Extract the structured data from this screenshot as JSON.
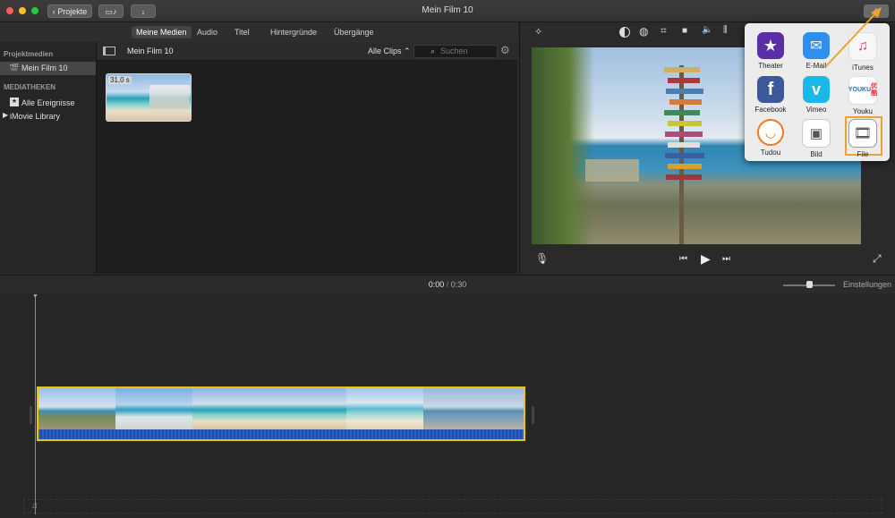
{
  "window": {
    "title": "Mein Film 10"
  },
  "toolbar": {
    "back_label": "Projekte"
  },
  "tabs": [
    {
      "label": "Meine Medien",
      "active": true
    },
    {
      "label": "Audio",
      "active": false
    },
    {
      "label": "Titel",
      "active": false
    },
    {
      "label": "Hintergründe",
      "active": false
    },
    {
      "label": "Übergänge",
      "active": false
    }
  ],
  "sidebar": {
    "project_heading": "Projektmedien",
    "project_item": "Mein Film 10",
    "libraries_heading": "MEDIATHEKEN",
    "items": [
      "Alle Ereignisse",
      "iMovie Library"
    ]
  },
  "browser": {
    "title": "Mein Film 10",
    "filter": "Alle Clips",
    "search_placeholder": "Suchen",
    "clip_duration": "31,0 s"
  },
  "share": {
    "apps": [
      {
        "label": "Theater",
        "icon": "star-icon",
        "color": "#5a2ea6"
      },
      {
        "label": "E-Mail",
        "icon": "mail-icon",
        "color": "#2d8ff0"
      },
      {
        "label": "iTunes",
        "icon": "music-note-icon",
        "color": "#f2f2f2"
      },
      {
        "label": "Facebook",
        "icon": "facebook-icon",
        "color": "#3b5998"
      },
      {
        "label": "Vimeo",
        "icon": "vimeo-icon",
        "color": "#1ab7ea"
      },
      {
        "label": "Youku",
        "icon": "youku-icon",
        "color": "#ffffff"
      },
      {
        "label": "Tudou",
        "icon": "tudou-icon",
        "color": "#ffffff"
      },
      {
        "label": "Bild",
        "icon": "image-icon",
        "color": "#ffffff"
      },
      {
        "label": "File",
        "icon": "film-icon",
        "color": "#ffffff"
      }
    ],
    "highlight_color": "#f0a030"
  },
  "timeline": {
    "current_time": "0:00",
    "separator": "/",
    "total_time": "0:30",
    "settings_label": "Einstellungen"
  }
}
